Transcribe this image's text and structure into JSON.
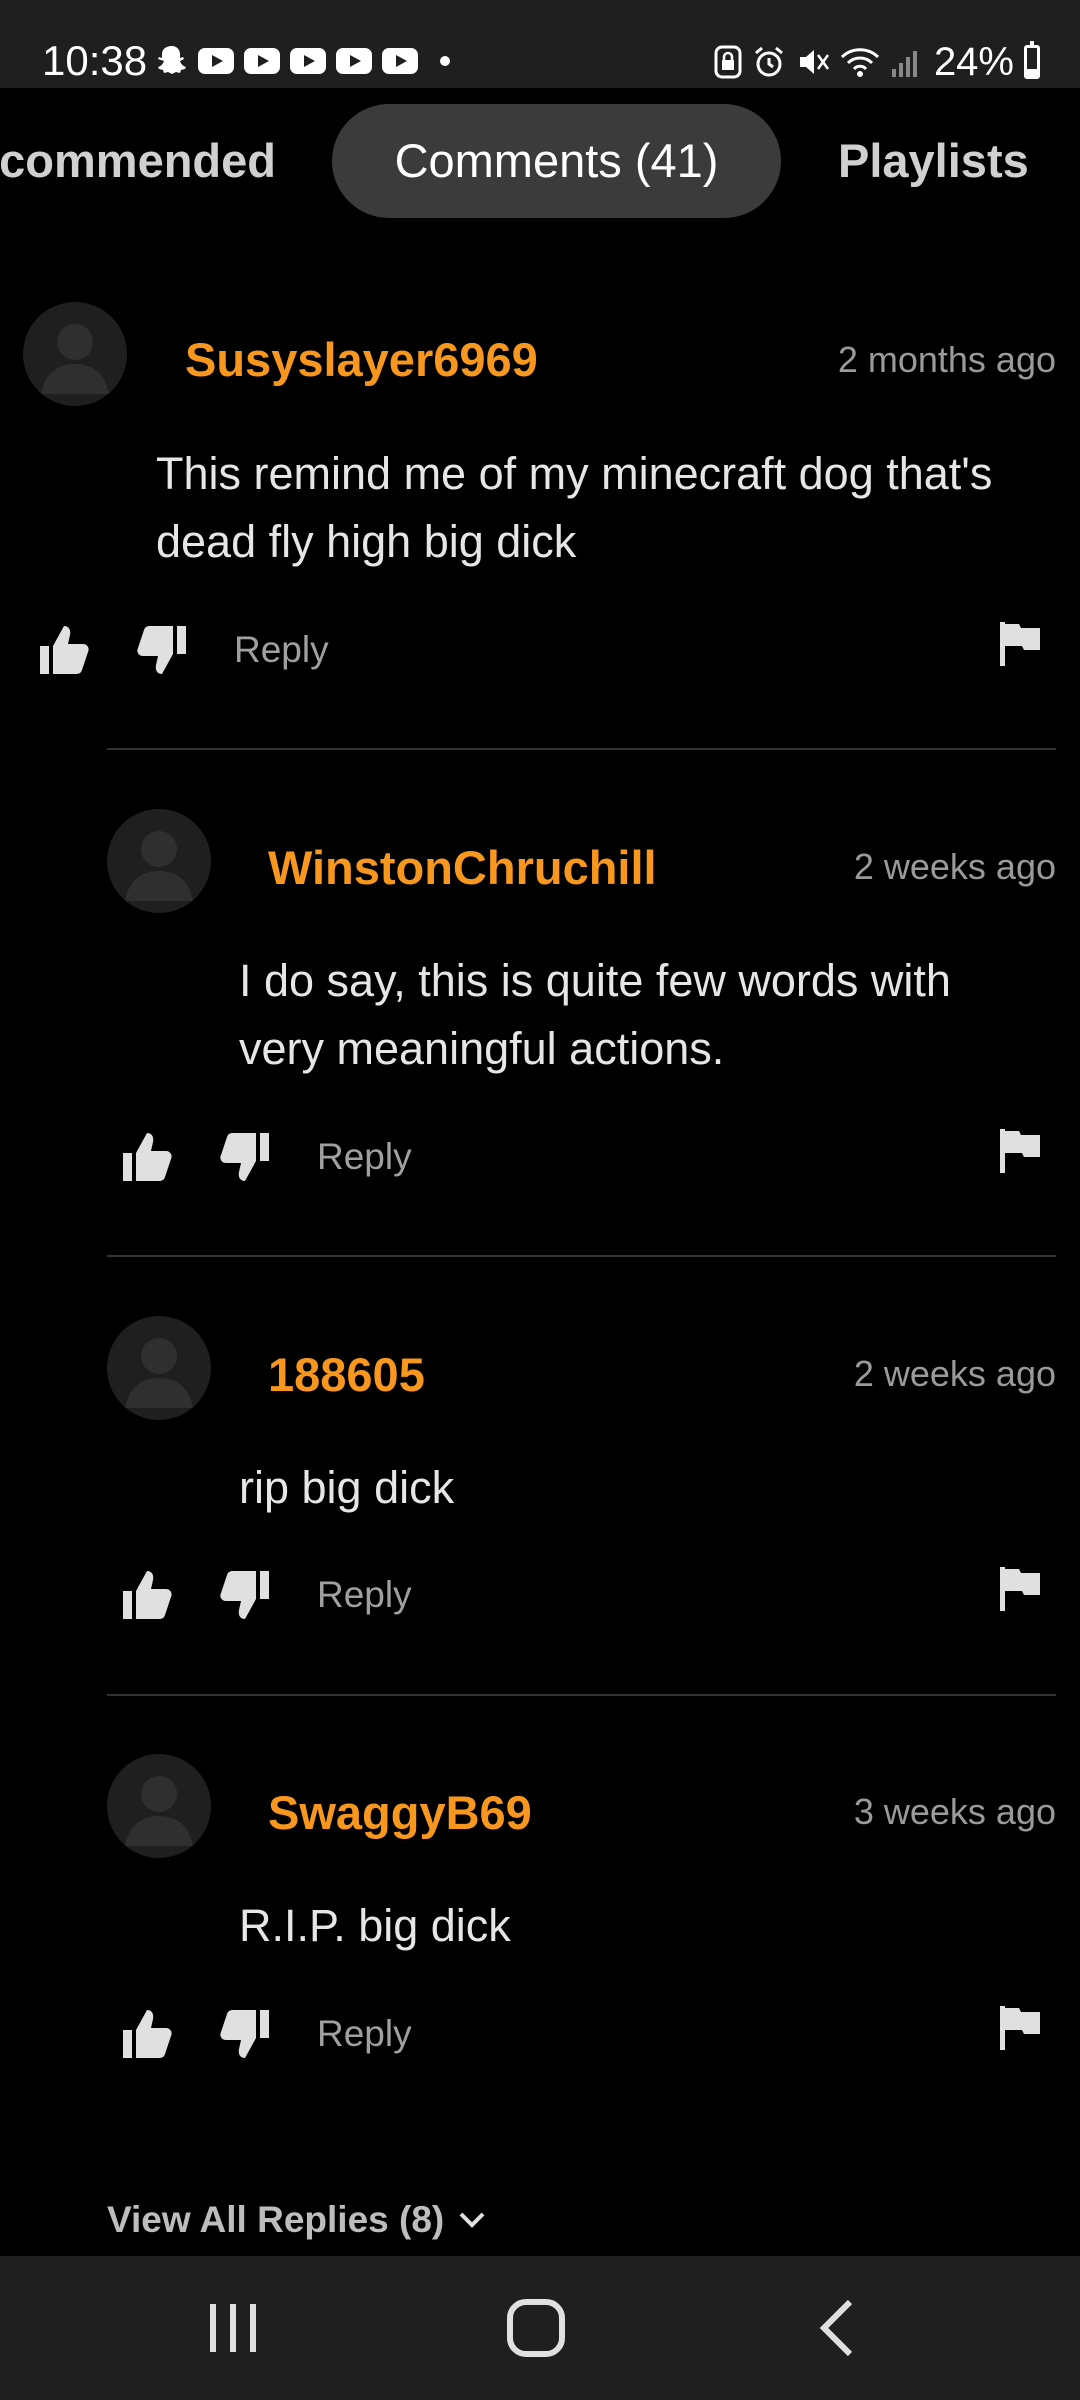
{
  "status_bar": {
    "time": "10:38",
    "battery_percent": "24%",
    "battery_level": 0.24,
    "notification_icons": [
      "snapchat-icon",
      "youtube-icon",
      "youtube-icon",
      "youtube-icon",
      "youtube-icon",
      "youtube-icon"
    ],
    "system_icons": [
      "screen-lock-icon",
      "alarm-icon",
      "mute-icon",
      "wifi-icon",
      "signal-icon",
      "battery-icon"
    ]
  },
  "tabs": [
    {
      "label": "ecommended",
      "active": false
    },
    {
      "label": "Comments (41)",
      "active": true
    },
    {
      "label": "Playlists",
      "active": false
    }
  ],
  "comments": [
    {
      "username": "Susyslayer6969",
      "time": "2 months ago",
      "text_lines": [
        "This remind me of my minecraft dog that's",
        "dead fly high big dick"
      ],
      "reply_label": "Reply"
    },
    {
      "username": "WinstonChruchill",
      "time": "2 weeks ago",
      "text_lines": [
        "I do say, this is quite few words with",
        "very meaningful actions."
      ],
      "reply_label": "Reply"
    },
    {
      "username": "188605",
      "time": "2 weeks ago",
      "text_lines": [
        "rip big dick"
      ],
      "reply_label": "Reply"
    },
    {
      "username": "SwaggyB69",
      "time": "3 weeks ago",
      "text_lines": [
        "R.I.P. big dick"
      ],
      "reply_label": "Reply"
    }
  ],
  "view_all_replies": "View All Replies (8)",
  "colors": {
    "username": "#f7971e",
    "background": "#000000",
    "active_tab": "#3b3b3b"
  },
  "nav_bar": {
    "icons": [
      "recent-apps-icon",
      "home-icon",
      "back-icon"
    ]
  }
}
